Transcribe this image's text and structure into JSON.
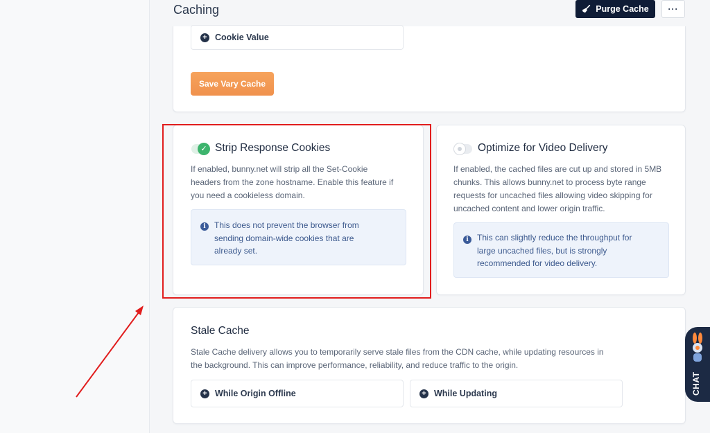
{
  "header": {
    "title": "Caching",
    "purge_label": "Purge Cache",
    "more_label": "···"
  },
  "vary_cache": {
    "cookie_value_label": "Cookie Value",
    "save_label": "Save Vary Cache"
  },
  "strip_cookies": {
    "title": "Strip Response Cookies",
    "enabled": true,
    "desc_lines": [
      "If enabled, bunny.net will strip all the Set-Cookie",
      "headers from the zone hostname. Enable this feature if",
      "you need a cookieless domain."
    ],
    "info_lines": [
      "This does not prevent the browser from",
      "sending domain-wide cookies that are",
      "already set."
    ]
  },
  "video_delivery": {
    "title": "Optimize for Video Delivery",
    "enabled": false,
    "desc_lines": [
      "If enabled, the cached files are cut up and stored in 5MB",
      "chunks. This allows bunny.net to process byte range",
      "requests for uncached files allowing video skipping for",
      "uncached content and lower origin traffic."
    ],
    "info_lines": [
      "This can slightly reduce the throughput for",
      "large uncached files, but is strongly",
      "recommended for video delivery."
    ]
  },
  "stale_cache": {
    "title": "Stale Cache",
    "desc_lines": [
      "Stale Cache delivery allows you to temporarily serve stale files from the CDN cache, while updating resources in",
      "the background. This can improve performance, reliability, and reduce traffic to the origin."
    ],
    "options": [
      "While Origin Offline",
      "While Updating"
    ]
  },
  "chat": {
    "label": "CHAT"
  },
  "colors": {
    "accent_dark": "#0f1c36",
    "save_orange": "#f0914d",
    "toggle_green": "#3db46d",
    "annotation_red": "#e11d1d"
  }
}
